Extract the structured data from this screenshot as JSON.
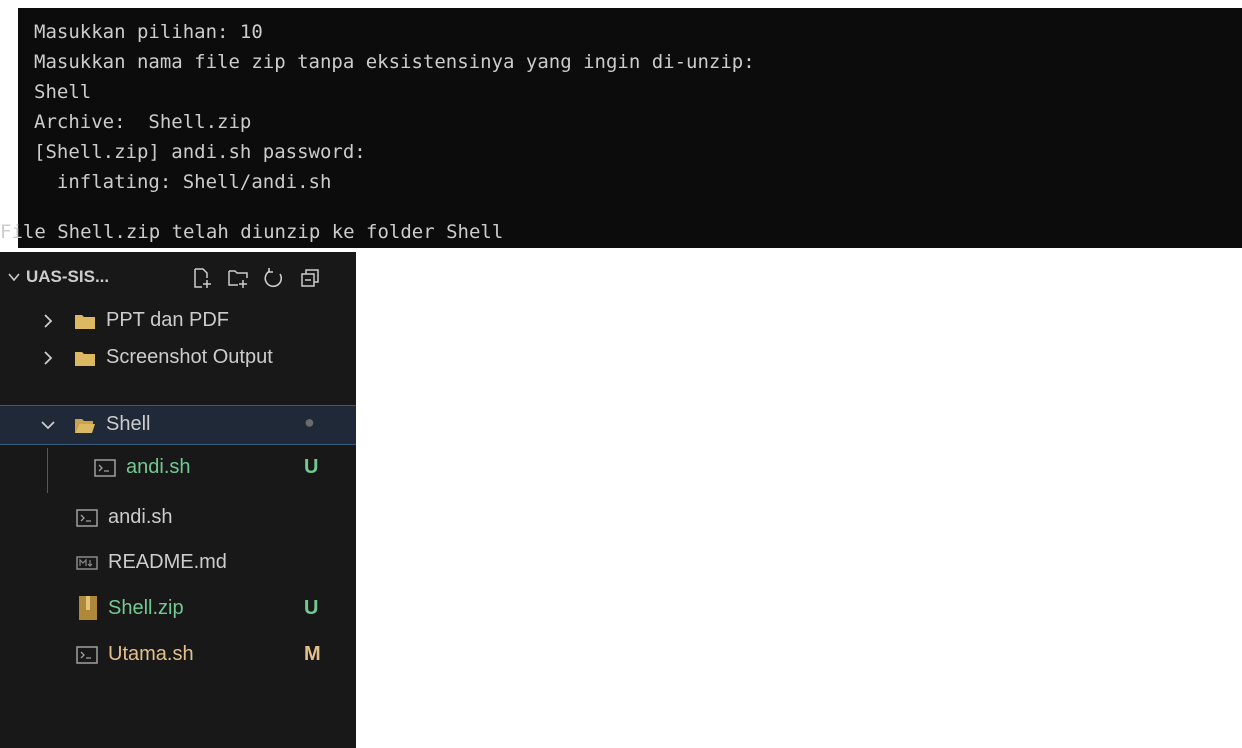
{
  "terminal": {
    "lines": [
      "Masukkan pilihan: 10",
      "Masukkan nama file zip tanpa eksistensinya yang ingin di-unzip:",
      "Shell",
      "Archive:  Shell.zip",
      "[Shell.zip] andi.sh password:",
      "  inflating: Shell/andi.sh",
      "File Shell.zip telah diunzip ke folder Shell"
    ]
  },
  "explorer": {
    "title": "UAS-SIS...",
    "header_icons": [
      "new-file-icon",
      "new-folder-icon",
      "refresh-icon",
      "collapse-all-icon"
    ],
    "items": [
      {
        "label": "PPT dan PDF",
        "type": "folder",
        "expanded": false,
        "badge": ""
      },
      {
        "label": "Screenshot Output",
        "type": "folder",
        "expanded": false,
        "badge": ""
      },
      {
        "label": "Shell",
        "type": "folder",
        "expanded": true,
        "badge": "●"
      },
      {
        "label": "andi.sh",
        "type": "shell-file",
        "badge": "U"
      },
      {
        "label": "andi.sh",
        "type": "shell-file",
        "badge": ""
      },
      {
        "label": "README.md",
        "type": "markdown-file",
        "badge": ""
      },
      {
        "label": "Shell.zip",
        "type": "zip-file",
        "badge": "U"
      },
      {
        "label": "Utama.sh",
        "type": "shell-file",
        "badge": "M"
      }
    ],
    "colors": {
      "untracked": "#73c991",
      "modified": "#e2c08d",
      "folder": "#dcb862",
      "background": "#181818",
      "selection": "#1f2937"
    }
  }
}
